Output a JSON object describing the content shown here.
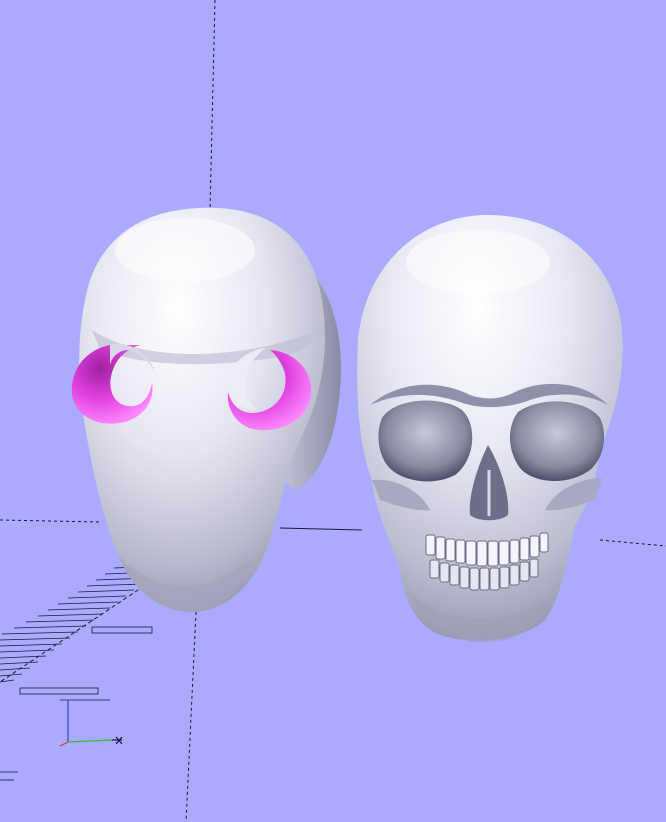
{
  "viewport": {
    "background_color": "#aaaaff",
    "axis_color": "#1a1a3a",
    "axis_x_color": "#e03030",
    "axis_y_color": "#30c030",
    "axis_z_color": "#3040e0"
  },
  "models": [
    {
      "name": "hollowed-head-shell",
      "surface_color": "#e8e8f4",
      "cut_face_color": "#e040e0"
    },
    {
      "name": "skull",
      "surface_color": "#ececf6"
    }
  ]
}
